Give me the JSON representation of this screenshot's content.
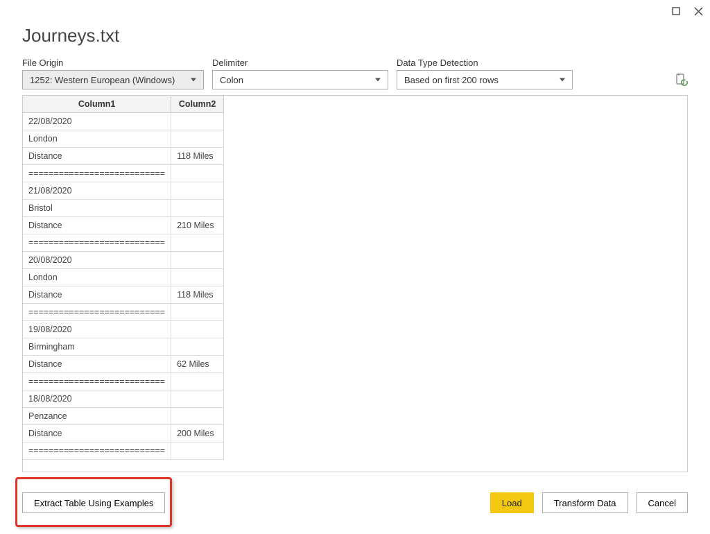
{
  "window": {
    "title": "Journeys.txt"
  },
  "controls": {
    "fileOrigin": {
      "label": "File Origin",
      "value": "1252: Western European (Windows)"
    },
    "delimiter": {
      "label": "Delimiter",
      "value": "Colon"
    },
    "dataType": {
      "label": "Data Type Detection",
      "value": "Based on first 200 rows"
    }
  },
  "table": {
    "headers": [
      "Column1",
      "Column2"
    ],
    "rows": [
      [
        "22/08/2020",
        ""
      ],
      [
        "London",
        ""
      ],
      [
        "Distance",
        "118 Miles"
      ],
      [
        "===========================",
        ""
      ],
      [
        "21/08/2020",
        ""
      ],
      [
        "Bristol",
        ""
      ],
      [
        "Distance",
        "210 Miles"
      ],
      [
        "===========================",
        ""
      ],
      [
        "20/08/2020",
        ""
      ],
      [
        "London",
        ""
      ],
      [
        "Distance",
        "118 Miles"
      ],
      [
        "===========================",
        ""
      ],
      [
        "19/08/2020",
        ""
      ],
      [
        "Birmingham",
        ""
      ],
      [
        "Distance",
        "62 Miles"
      ],
      [
        "===========================",
        ""
      ],
      [
        "18/08/2020",
        ""
      ],
      [
        "Penzance",
        ""
      ],
      [
        "Distance",
        "200 Miles"
      ],
      [
        "===========================",
        ""
      ]
    ]
  },
  "footer": {
    "extract": "Extract Table Using Examples",
    "load": "Load",
    "transform": "Transform Data",
    "cancel": "Cancel"
  }
}
